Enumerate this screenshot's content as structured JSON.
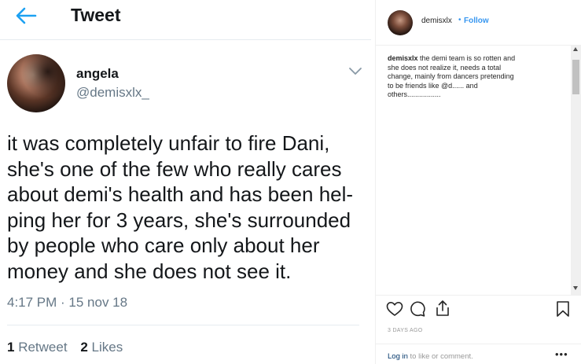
{
  "tweet": {
    "header_title": "Tweet",
    "author_name": "angela",
    "author_handle": "@demisxlx_",
    "text": "it was completely unfair to fire Dani,\nshe's one of the few who really cares\nabout demi's health and has been hel-\nping her for 3 years, she's surrounded\nby people who care only about her\nmoney and she does not see it.",
    "time": "4:17 PM · 15 nov 18",
    "retweets_count": "1",
    "retweets_label": "Retweet",
    "likes_count": "2",
    "likes_label": "Likes",
    "accent_color": "#1da1f2"
  },
  "instagram": {
    "username": "demisxlx",
    "separator": "•",
    "follow_label": "Follow",
    "caption_user": "demisxlx",
    "caption_text": " the demi team is so rotten and\nshe does not realize it, needs a total\nchange, mainly from dancers pretending\nto be friends like @d...... and\nothers.................",
    "date": "3 DAYS AGO",
    "login_link": "Log in",
    "login_rest": " to like or comment.",
    "more_label": "•••",
    "follow_color": "#3897f0"
  },
  "icons": [
    "back-arrow-icon",
    "chevron-down-icon",
    "heart-icon",
    "comment-icon",
    "share-icon",
    "bookmark-icon"
  ]
}
